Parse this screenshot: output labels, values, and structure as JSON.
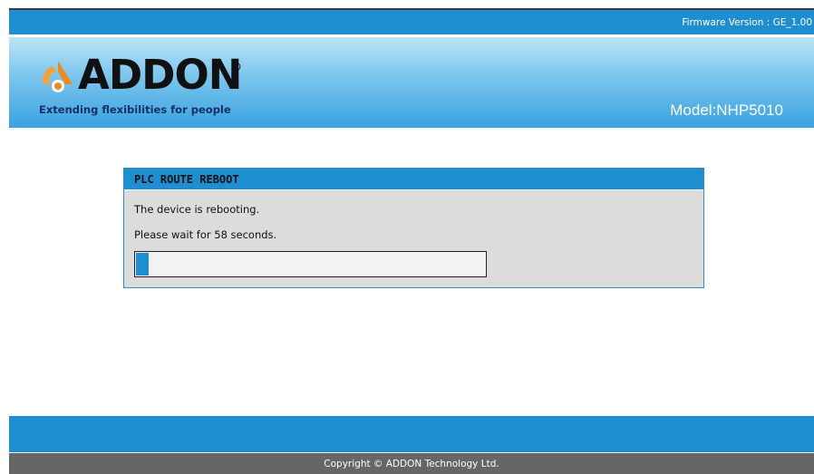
{
  "header": {
    "firmware_version": "Firmware Version : GE_1.00",
    "logo_text": "ADDON",
    "logo_registered": "®",
    "tagline": "Extending flexibilities for people",
    "model": "Model:NHP5010"
  },
  "panel": {
    "title": "PLC ROUTE REBOOT",
    "message": "The device is rebooting.",
    "wait_text": "Please wait for 58 seconds.",
    "progress_fraction": 0.035
  },
  "footer": {
    "copyright": "Copyright © ADDON Technology Ltd."
  },
  "colors": {
    "accent_blue": "#1e8ed1",
    "footer_gray": "#666666",
    "panel_bg": "#dcdcdc"
  }
}
